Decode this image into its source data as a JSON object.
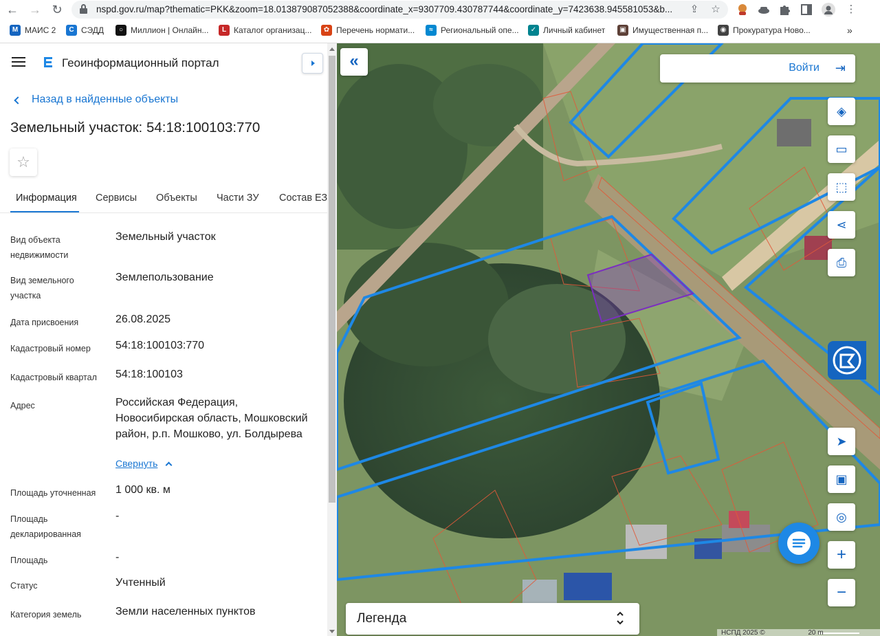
{
  "browser": {
    "url": "nspd.gov.ru/map?thematic=PKK&zoom=18.013879087052388&coordinate_x=9307709.430787744&coordinate_y=7423638.945581053&b...",
    "nav_back": "←",
    "nav_forward": "→",
    "reload": "↻",
    "share_icon": "⇪",
    "star_icon": "☆",
    "more_icon": "⋮",
    "bookmarks": [
      {
        "label": "МАИС 2",
        "color": "#1565c0",
        "glyph": "М"
      },
      {
        "label": "СЭДД",
        "color": "#1976d2",
        "glyph": "С"
      },
      {
        "label": "Миллион | Онлайн...",
        "color": "#111111",
        "glyph": "○"
      },
      {
        "label": "Каталог организац...",
        "color": "#c62828",
        "glyph": "L"
      },
      {
        "label": "Перечень нормати...",
        "color": "#d84315",
        "glyph": "✿"
      },
      {
        "label": "Региональный опе...",
        "color": "#0288d1",
        "glyph": "≈"
      },
      {
        "label": "Личный кабинет",
        "color": "#00838f",
        "glyph": "✓"
      },
      {
        "label": "Имущественная п...",
        "color": "#5d4037",
        "glyph": "▣"
      },
      {
        "label": "Прокуратура Ново...",
        "color": "#424242",
        "glyph": "◉"
      }
    ],
    "more_bookmarks": "»"
  },
  "panel": {
    "portal_title": "Геоинформационный портал",
    "back_link": "Назад в найденные объекты",
    "object_title": "Земельный участок: 54:18:100103:770",
    "favorite_icon": "☆",
    "tabs": [
      {
        "label": "Информация"
      },
      {
        "label": "Сервисы"
      },
      {
        "label": "Объекты"
      },
      {
        "label": "Части ЗУ"
      },
      {
        "label": "Состав ЕЗП"
      }
    ],
    "properties": [
      {
        "key": "Вид объекта недвижимости",
        "value": "Земельный участок"
      },
      {
        "key": "Вид земельного участка",
        "value": "Землепользование"
      },
      {
        "key": "Дата присвоения",
        "value": "26.08.2025"
      },
      {
        "key": "Кадастровый номер",
        "value": "54:18:100103:770"
      },
      {
        "key": "Кадастровый квартал",
        "value": "54:18:100103"
      },
      {
        "key": "Адрес",
        "value": "Российская Федерация, Новосибирская область, Мошковский район, р.п. Мошково, ул. Болдырева"
      },
      {
        "key": "Площадь уточненная",
        "value": "1 000 кв. м"
      },
      {
        "key": "Площадь декларированная",
        "value": "-"
      },
      {
        "key": "Площадь",
        "value": "-"
      },
      {
        "key": "Статус",
        "value": "Учтенный"
      },
      {
        "key": "Категория земель",
        "value": "Земли населенных пунктов"
      }
    ],
    "collapse_link": "Свернуть"
  },
  "map": {
    "collapse_icon": "«",
    "login_label": "Войти",
    "login_icon": "⇥",
    "tools": [
      {
        "name": "layers-icon",
        "glyph": "◈"
      },
      {
        "name": "ruler-icon",
        "glyph": "▭"
      },
      {
        "name": "select-area-icon",
        "glyph": "⬚"
      },
      {
        "name": "share-icon",
        "glyph": "⋖"
      },
      {
        "name": "print-icon",
        "glyph": "⎙"
      }
    ],
    "nav_tools": [
      {
        "name": "locate-icon",
        "glyph": "➤"
      },
      {
        "name": "minimap-icon",
        "glyph": "▣"
      },
      {
        "name": "geolocation-icon",
        "glyph": "◎"
      },
      {
        "name": "zoom-in-icon",
        "glyph": "+"
      },
      {
        "name": "zoom-out-icon",
        "glyph": "−"
      }
    ],
    "legend_label": "Легенда",
    "attribution": "НСПД 2025 ©",
    "scale_label": "20 m",
    "colors": {
      "parcel_border": "#1e88e5",
      "selected_parcel": "#7b2fbf",
      "cadastral_line": "#e05a3a"
    }
  }
}
